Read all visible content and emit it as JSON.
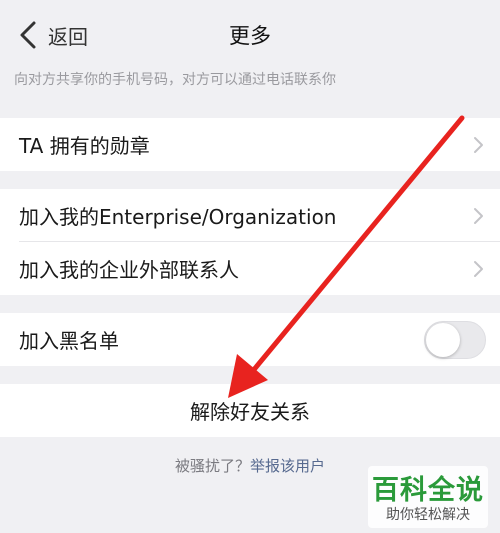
{
  "navbar": {
    "back_label": "返回",
    "title": "更多"
  },
  "hint": "向对方共享你的手机号码，对方可以通过电话联系你",
  "groups": {
    "badges": {
      "label": "TA 拥有的勋章"
    },
    "join_enterprise": {
      "label": "加入我的Enterprise/Organization"
    },
    "join_external": {
      "label": "加入我的企业外部联系人"
    },
    "blacklist": {
      "label": "加入黑名单",
      "toggle_on": false
    },
    "remove_friend": {
      "label": "解除好友关系"
    }
  },
  "report": {
    "question": "被骚扰了？",
    "link": "举报该用户"
  },
  "watermark": {
    "title": "百科全说",
    "subtitle": "助你轻松解决"
  },
  "colors": {
    "background": "#f0f0f3",
    "arrow": "#e8231f",
    "link": "#56698f",
    "watermark_green": "#2a9a3a"
  }
}
